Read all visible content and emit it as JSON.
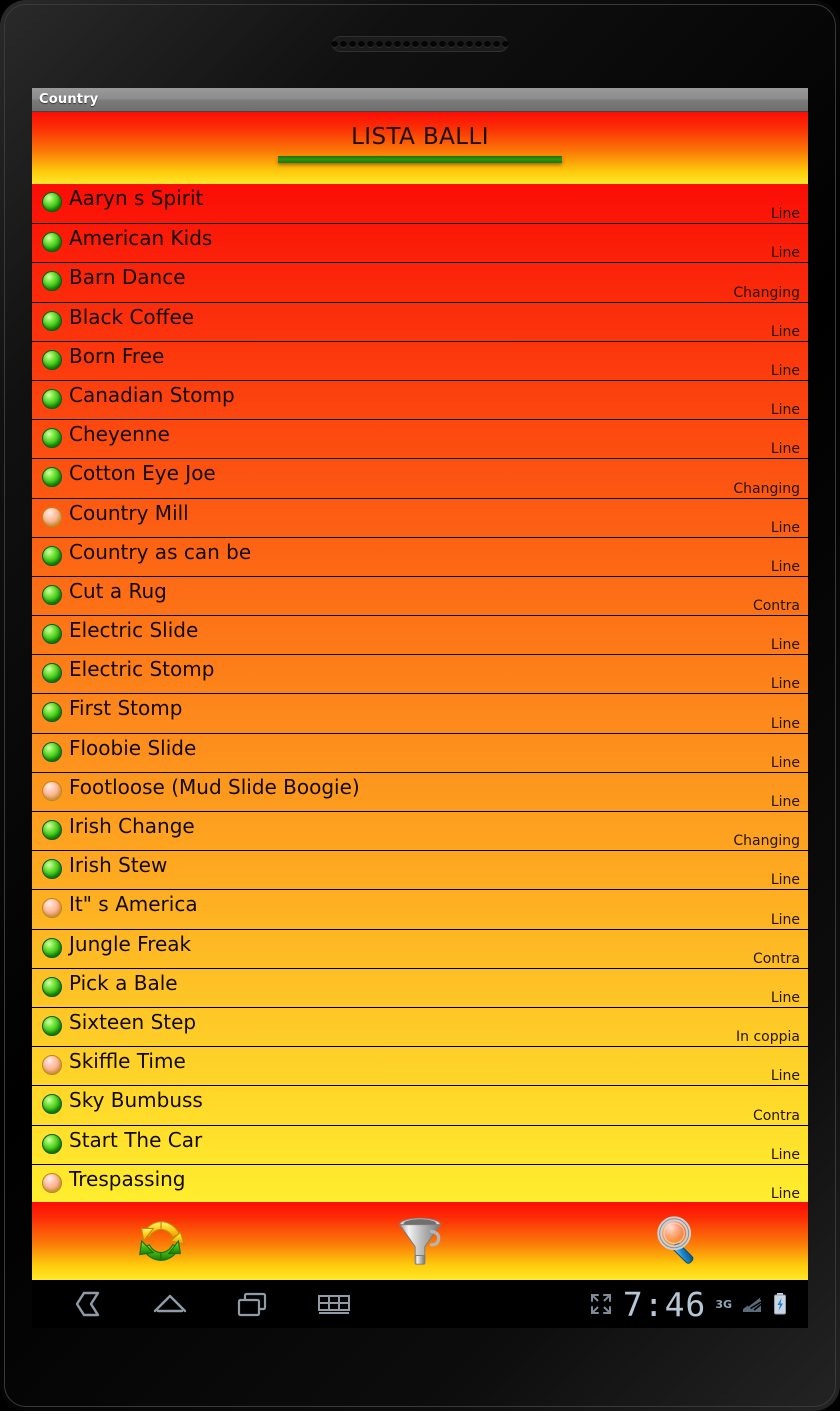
{
  "device": {
    "speaker_holes": 20
  },
  "window": {
    "title": "Country"
  },
  "header": {
    "title": "LISTA BALLI",
    "accent_underline_color": "#2d9a0a"
  },
  "list": {
    "rows": [
      {
        "name": "Aaryn s Spirit",
        "kind": "Line",
        "marker": "green"
      },
      {
        "name": "American Kids",
        "kind": "Line",
        "marker": "green"
      },
      {
        "name": "Barn Dance",
        "kind": "Changing",
        "marker": "green"
      },
      {
        "name": "Black Coffee",
        "kind": "Line",
        "marker": "green"
      },
      {
        "name": "Born Free",
        "kind": "Line",
        "marker": "green"
      },
      {
        "name": "Canadian Stomp",
        "kind": "Line",
        "marker": "green"
      },
      {
        "name": "Cheyenne",
        "kind": "Line",
        "marker": "green"
      },
      {
        "name": "Cotton Eye Joe",
        "kind": "Changing",
        "marker": "green"
      },
      {
        "name": "Country Mill",
        "kind": "Line",
        "marker": "pink"
      },
      {
        "name": "Country as can be",
        "kind": "Line",
        "marker": "green"
      },
      {
        "name": "Cut a Rug",
        "kind": "Contra",
        "marker": "green"
      },
      {
        "name": "Electric Slide",
        "kind": "Line",
        "marker": "green"
      },
      {
        "name": "Electric Stomp",
        "kind": "Line",
        "marker": "green"
      },
      {
        "name": "First Stomp",
        "kind": "Line",
        "marker": "green"
      },
      {
        "name": "Floobie Slide",
        "kind": "Line",
        "marker": "green"
      },
      {
        "name": "Footloose (Mud Slide Boogie)",
        "kind": "Line",
        "marker": "pink"
      },
      {
        "name": "Irish Change",
        "kind": "Changing",
        "marker": "green"
      },
      {
        "name": "Irish Stew",
        "kind": "Line",
        "marker": "green"
      },
      {
        "name": "It\" s America",
        "kind": "Line",
        "marker": "pink"
      },
      {
        "name": "Jungle Freak",
        "kind": "Contra",
        "marker": "green"
      },
      {
        "name": "Pick a Bale",
        "kind": "Line",
        "marker": "green"
      },
      {
        "name": "Sixteen Step",
        "kind": "In coppia",
        "marker": "green"
      },
      {
        "name": "Skiffle Time",
        "kind": "Line",
        "marker": "pink"
      },
      {
        "name": "Sky Bumbuss",
        "kind": "Contra",
        "marker": "green"
      },
      {
        "name": "Start The Car",
        "kind": "Line",
        "marker": "green"
      },
      {
        "name": "Trespassing",
        "kind": "Line",
        "marker": "pink"
      }
    ]
  },
  "actionbar": {
    "buttons": [
      {
        "icon": "refresh-icon",
        "label": "Refresh"
      },
      {
        "icon": "funnel-filter-icon",
        "label": "Filter"
      },
      {
        "icon": "magnifier-search-icon",
        "label": "Search"
      }
    ]
  },
  "systembar": {
    "back_icon": "back-icon",
    "home_icon": "home-icon",
    "recents_icon": "recent-apps-icon",
    "keyboard_icon": "keyboard-icon",
    "fullscreen_icon": "fullscreen-icon",
    "clock": "7:46",
    "network": "3G",
    "battery_icon": "battery-charging-icon"
  }
}
